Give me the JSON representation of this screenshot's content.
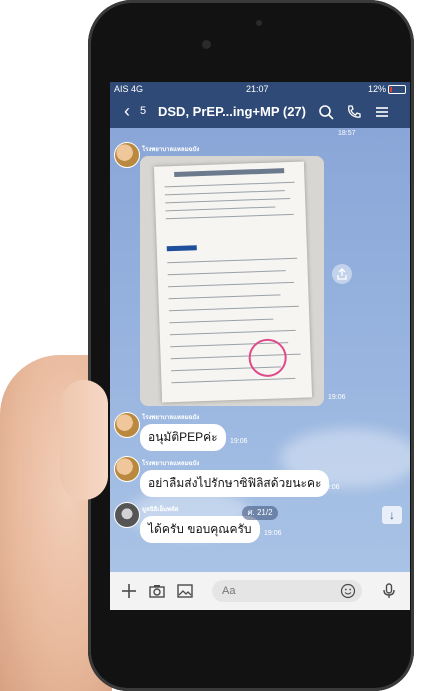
{
  "status_bar": {
    "carrier": "AIS 4G",
    "time": "21:07",
    "battery": "12%",
    "battery_level": 0.12,
    "battery_color": "#e53935"
  },
  "header": {
    "back_count": "5",
    "title": "DSD, PrEP...ing+MP (27)"
  },
  "chat": {
    "top_time": "18:57",
    "sender1_name": "โรงพยาบาลแหลมฉบัง",
    "photo_time": "19:06",
    "messages": [
      {
        "sender": "โรงพยาบาลแหลมฉบัง",
        "text": "อนุมัติPEPค่ะ",
        "time": "19:06"
      },
      {
        "sender": "โรงพยาบาลแหลมฉบัง",
        "text": "อย่าลืมส่งไปรักษาซิฟิลิสด้วยนะคะ",
        "time": "19:06"
      },
      {
        "sender": "มูลนิธิเอ็มพลัส",
        "text": "ได้ครับ ขอบคุณครับ",
        "time": "19:06"
      }
    ],
    "date_pill": "ศ. 21/2"
  },
  "input_bar": {
    "placeholder": "Aa"
  },
  "colors": {
    "header_bg": "#2f4a76",
    "chat_bg": "#8ea8d6",
    "accent": "#3b5b8a"
  },
  "icons": [
    "chevron-left-icon",
    "search-icon",
    "phone-icon",
    "menu-icon",
    "share-icon",
    "arrow-down-icon",
    "plus-icon",
    "camera-icon",
    "image-icon",
    "smile-icon",
    "mic-icon"
  ]
}
